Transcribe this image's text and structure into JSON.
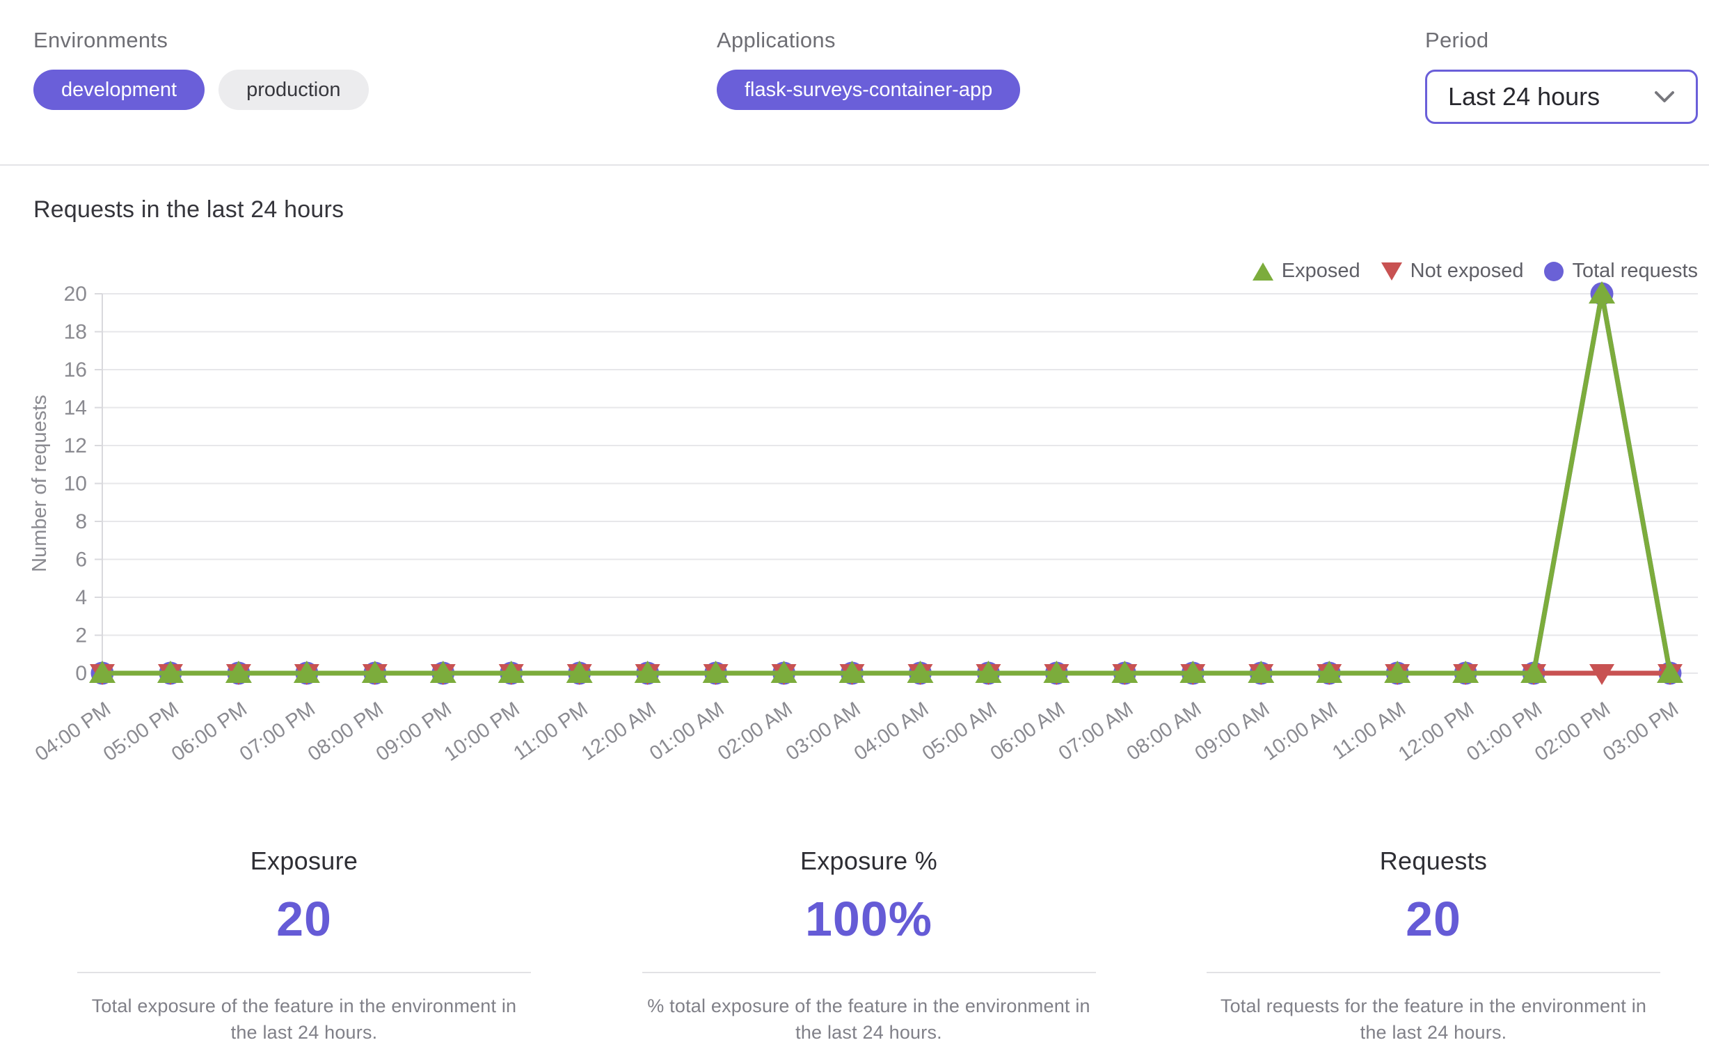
{
  "filters": {
    "environments": {
      "label": "Environments",
      "chips": [
        {
          "text": "development",
          "selected": true
        },
        {
          "text": "production",
          "selected": false
        }
      ]
    },
    "applications": {
      "label": "Applications",
      "chips": [
        {
          "text": "flask-surveys-container-app",
          "selected": true
        }
      ]
    },
    "period": {
      "label": "Period",
      "value": "Last 24 hours"
    }
  },
  "chart": {
    "title": "Requests in the last 24 hours",
    "legend": [
      {
        "label": "Exposed",
        "shape": "triangle-up",
        "color": "#7CAC3C"
      },
      {
        "label": "Not exposed",
        "shape": "triangle-down",
        "color": "#C85252"
      },
      {
        "label": "Total requests",
        "shape": "circle",
        "color": "#6A61D6"
      }
    ]
  },
  "chart_data": {
    "type": "line",
    "title": "Requests in the last 24 hours",
    "xlabel": "",
    "ylabel": "Number of requests",
    "ylim": [
      0,
      20
    ],
    "ytick_step": 2,
    "grid": true,
    "legend_position": "top-right",
    "categories": [
      "04:00 PM",
      "05:00 PM",
      "06:00 PM",
      "07:00 PM",
      "08:00 PM",
      "09:00 PM",
      "10:00 PM",
      "11:00 PM",
      "12:00 AM",
      "01:00 AM",
      "02:00 AM",
      "03:00 AM",
      "04:00 AM",
      "05:00 AM",
      "06:00 AM",
      "07:00 AM",
      "08:00 AM",
      "09:00 AM",
      "10:00 AM",
      "11:00 AM",
      "12:00 PM",
      "01:00 PM",
      "02:00 PM",
      "03:00 PM"
    ],
    "series": [
      {
        "name": "Exposed",
        "color": "#7CAC3C",
        "marker": "triangle-up",
        "values": [
          0,
          0,
          0,
          0,
          0,
          0,
          0,
          0,
          0,
          0,
          0,
          0,
          0,
          0,
          0,
          0,
          0,
          0,
          0,
          0,
          0,
          0,
          20,
          0
        ]
      },
      {
        "name": "Not exposed",
        "color": "#C85252",
        "marker": "triangle-down",
        "values": [
          0,
          0,
          0,
          0,
          0,
          0,
          0,
          0,
          0,
          0,
          0,
          0,
          0,
          0,
          0,
          0,
          0,
          0,
          0,
          0,
          0,
          0,
          0,
          0
        ]
      },
      {
        "name": "Total requests",
        "color": "#6A61D6",
        "marker": "circle",
        "values": [
          0,
          0,
          0,
          0,
          0,
          0,
          0,
          0,
          0,
          0,
          0,
          0,
          0,
          0,
          0,
          0,
          0,
          0,
          0,
          0,
          0,
          0,
          20,
          0
        ]
      }
    ]
  },
  "stats": [
    {
      "title": "Exposure",
      "value": "20",
      "description": "Total exposure of the feature in the environment in the last 24 hours."
    },
    {
      "title": "Exposure %",
      "value": "100%",
      "description": "% total exposure of the feature in the environment in the last 24 hours."
    },
    {
      "title": "Requests",
      "value": "20",
      "description": "Total requests for the feature in the environment in the last 24 hours."
    }
  ],
  "colors": {
    "accent_purple": "#6A5FD9",
    "stat_value_purple": "#655BD6",
    "exposed_green": "#7CAC3C",
    "not_exposed_red": "#C85252",
    "total_requests_purple": "#6A61D6",
    "grid_gray": "#E7E7EA",
    "text_gray": "#6E6E74"
  }
}
